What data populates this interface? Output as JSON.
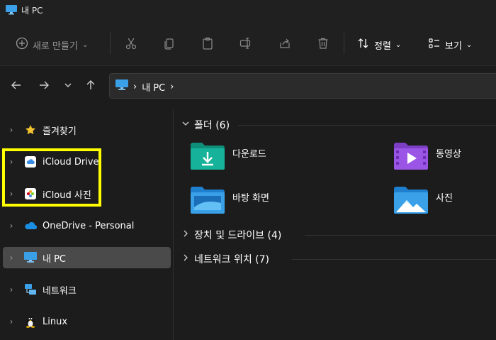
{
  "window": {
    "title": "내 PC"
  },
  "toolbar": {
    "new_label": "새로 만들기",
    "sort_label": "정렬",
    "view_label": "보기"
  },
  "address": {
    "path": [
      "내 PC"
    ]
  },
  "sidebar": {
    "items": [
      {
        "label": "즐겨찾기",
        "icon": "star-icon"
      },
      {
        "label": "iCloud Drive",
        "icon": "icloud-icon"
      },
      {
        "label": "iCloud 사진",
        "icon": "icloud-photos-icon"
      },
      {
        "label": "OneDrive - Personal",
        "icon": "onedrive-icon"
      },
      {
        "label": "내 PC",
        "icon": "pc-icon",
        "active": true
      },
      {
        "label": "네트워크",
        "icon": "network-icon"
      },
      {
        "label": "Linux",
        "icon": "linux-icon"
      }
    ]
  },
  "main": {
    "groups": [
      {
        "label": "폴더 (6)",
        "expanded": true
      },
      {
        "label": "장치 및 드라이브 (4)",
        "expanded": false
      },
      {
        "label": "네트워크 위치 (7)",
        "expanded": false
      }
    ],
    "folders": [
      {
        "label": "다운로드",
        "icon": "downloads-folder-icon"
      },
      {
        "label": "동영상",
        "icon": "videos-folder-icon"
      },
      {
        "label": "바탕 화면",
        "icon": "desktop-folder-icon"
      },
      {
        "label": "사진",
        "icon": "pictures-folder-icon"
      }
    ]
  },
  "colors": {
    "highlight": "#ffff00",
    "active_item": "#4a4a4a",
    "background": "#1c1c1c"
  }
}
